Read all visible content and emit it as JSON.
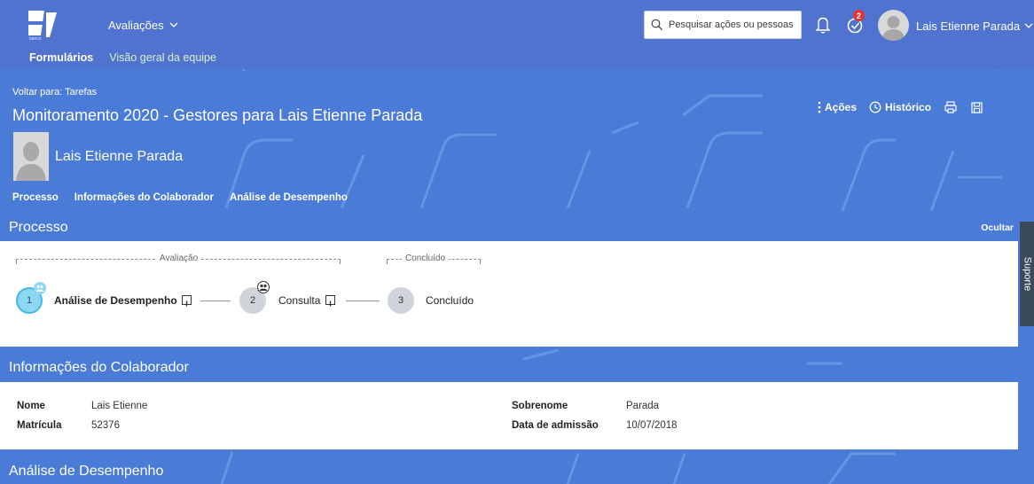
{
  "shell": {
    "logo_sub": "banco",
    "module_label": "Avaliações",
    "tabs": [
      {
        "label": "Formulários"
      },
      {
        "label": "Visão geral da equipe"
      }
    ],
    "search_placeholder": "Pesquisar ações ou pessoas",
    "notification_badge": "2",
    "user_name": "Lais Etienne Parada"
  },
  "header": {
    "back_link": "Voltar para: Tarefas",
    "title": "Monitoramento 2020 - Gestores para Lais Etienne Parada",
    "actions": {
      "acoes": "Ações",
      "historico": "Histórico"
    },
    "employee_name": "Lais Etienne Parada",
    "anchors": [
      "Processo",
      "Informações do Colaborador",
      "Análise de Desempenho"
    ]
  },
  "process": {
    "title": "Processo",
    "hide_label": "Ocultar",
    "phases": [
      "Avaliação",
      "Concluído"
    ],
    "steps": [
      {
        "number": "1",
        "label": "Análise de Desempenho"
      },
      {
        "number": "2",
        "label": "Consulta"
      },
      {
        "number": "3",
        "label": "Concluído"
      }
    ]
  },
  "collaborator": {
    "title": "Informações do Colaborador",
    "fields": {
      "nome_label": "Nome",
      "nome_value": "Lais Etienne",
      "matricula_label": "Matrícula",
      "matricula_value": "52376",
      "sobrenome_label": "Sobrenome",
      "sobrenome_value": "Parada",
      "admissao_label": "Data de admissão",
      "admissao_value": "10/07/2018"
    }
  },
  "performance": {
    "title": "Análise de Desempenho"
  },
  "support_label": "Suporte",
  "colors": {
    "shell": "#4f73cf",
    "page": "#4a7bd6",
    "active_step": "#8dd7f2",
    "badge": "#e03535"
  }
}
